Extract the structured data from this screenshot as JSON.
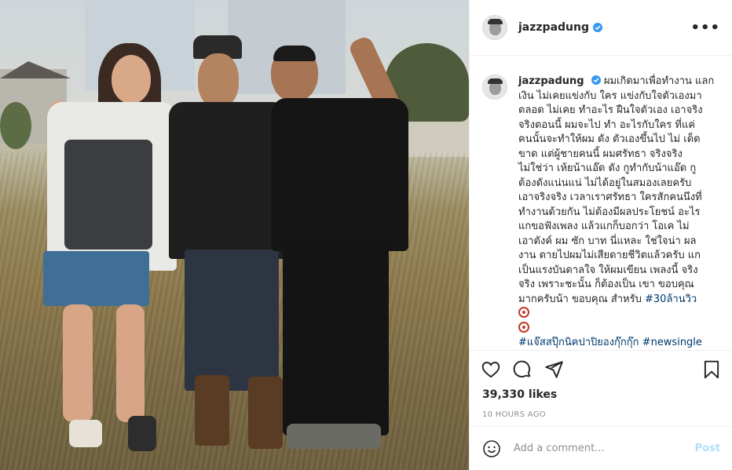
{
  "post": {
    "username": "jazzpadung",
    "verified": true,
    "more_label": "•••",
    "caption_lines": [
      "ผมเกิดมาเพื่อทำงาน แลก",
      "เงิน ไม่เคยแข่งกับ ใคร แข่งกับใจตัวเองมา",
      "ตลอด ไม่เคย ทำอะไร ฝืนใจตัวเอง เอาจริง",
      "จริงตอนนี้ ผมจะไป ทำ อะไรกับใคร ที่แค่",
      "คนนั้นจะทำให้ผม ดัง ตัวเองขึ้นไป ไม่ เด็ด",
      "ขาด แต่ผู้ชายคนนี้ ผมศรัทธา จริงจริง",
      "ไม่ใช่ว่า เห้ยน้าแอ๊ด ดัง กูทำกับน้าแอ๊ด กู",
      "ต้องดังแน่นแน่ ไม่ได้อยู่ในสมองเลยครับ",
      "เอาจริงจริง เวลาเราศรัทธา ใครสักคนนึงที่",
      "ทำงานด้วยกัน ไม่ต้องมีผลประโยชน์ อะไร",
      "แกขอฟังเพลง แล้วแกก็บอกว่า โอเค ไม่",
      "เอาตังค์ ผม ซัก บาท นี่แหละ ใช่ใจน่า ผล",
      "งาน ตายไปผมไม่เสียดายชีวิตแล้วครับ แก",
      "เป็นแรงบันดาลใจ ให้ผมเขียน เพลงนี้ จริง",
      "จริง เพราะชะนั้น ก็ต้องเป็น เขา ขอบคุณ",
      "มากครับน้า ขอบคุณ สำหรับ"
    ],
    "hashtag_views": "#30ล้านวิว",
    "hashtag_line": "#แจ๊สสปุ๊กนิคปาปิยองกุ๊กกุ๊ก",
    "hashtag_line_2": "#newsingle",
    "likes": "39,330 likes",
    "timestamp": "10 HOURS AGO",
    "comment_placeholder": "Add a comment...",
    "post_button": "Post"
  },
  "icons": {
    "like": "heart-icon",
    "comment": "comment-icon",
    "share": "share-icon",
    "save": "bookmark-icon",
    "emoji": "smiley-icon",
    "verified": "verified-badge-icon"
  },
  "colors": {
    "verified": "#3897f0",
    "link": "#00376b",
    "muted": "#8e8e8e",
    "post_disabled": "#b2dffc"
  }
}
